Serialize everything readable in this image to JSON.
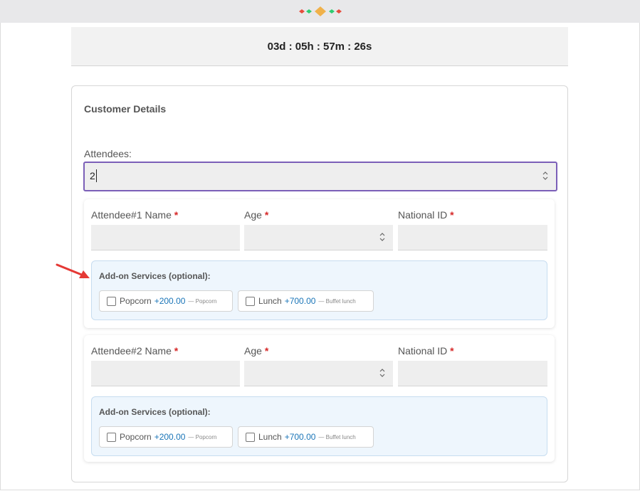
{
  "countdown": {
    "text": "03d : 05h : 57m : 26s"
  },
  "customer_details": {
    "title": "Customer Details",
    "attendees_label": "Attendees:",
    "attendees_value": "2"
  },
  "attendees": [
    {
      "name_label": "Attendee#1 Name",
      "age_label": "Age",
      "id_label": "National ID",
      "required_mark": "*",
      "addons_title": "Add-on Services (optional):",
      "addons": [
        {
          "label": "Popcorn",
          "price": "+200.00",
          "desc": "— Popcorn"
        },
        {
          "label": "Lunch",
          "price": "+700.00",
          "desc": "— Buffet lunch"
        }
      ]
    },
    {
      "name_label": "Attendee#2 Name",
      "age_label": "Age",
      "id_label": "National ID",
      "required_mark": "*",
      "addons_title": "Add-on Services (optional):",
      "addons": [
        {
          "label": "Popcorn",
          "price": "+200.00",
          "desc": "— Popcorn"
        },
        {
          "label": "Lunch",
          "price": "+700.00",
          "desc": "— Buffet lunch"
        }
      ]
    }
  ],
  "colors": {
    "focus_border": "#7b5fb8",
    "price": "#1a75b8",
    "required": "#d62828",
    "addon_panel": "#eef6fd",
    "annotation_arrow": "#e53935"
  },
  "icons": {
    "logo": "diamond-logo-icon",
    "spinner": "spinner-arrows-icon",
    "annotation": "red-arrow-icon"
  }
}
